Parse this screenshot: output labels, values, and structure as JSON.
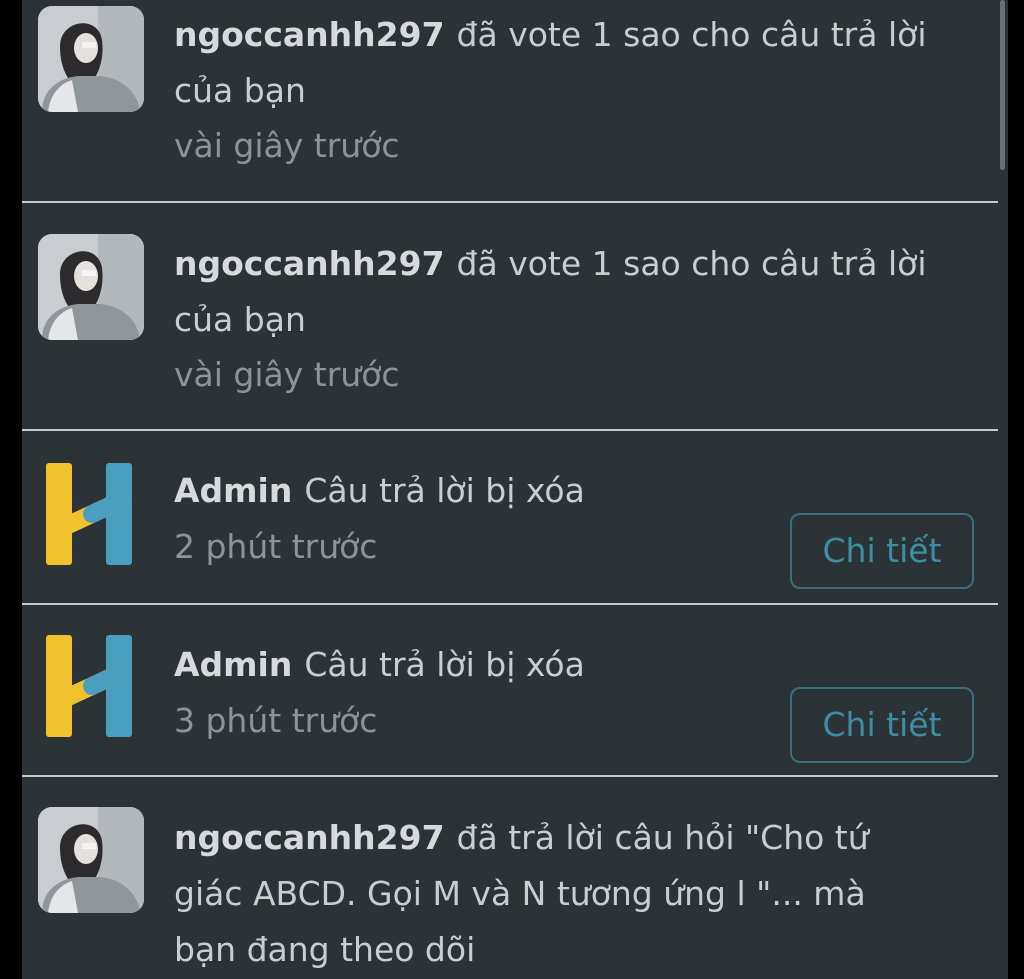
{
  "notifications": [
    {
      "user": "ngoccanhh297",
      "message": "đã vote 1 sao cho câu trả lời của bạn",
      "time": "vài giây trước",
      "avatar": "user-photo"
    },
    {
      "user": "ngoccanhh297",
      "message": "đã vote 1 sao cho câu trả lời của bạn",
      "time": "vài giây trước",
      "avatar": "user-photo"
    },
    {
      "user": "Admin",
      "message": "Câu trả lời bị xóa",
      "time": "2 phút trước",
      "avatar": "h-logo",
      "button": "Chi tiết"
    },
    {
      "user": "Admin",
      "message": "Câu trả lời bị xóa",
      "time": "3 phút trước",
      "avatar": "h-logo",
      "button": "Chi tiết"
    },
    {
      "user": "ngoccanhh297",
      "message": "đã trả lời câu hỏi \"Cho tứ giác ABCD. Gọi M và N tương ứng l \"... mà bạn đang theo dõi",
      "avatar": "user-photo"
    }
  ],
  "colors": {
    "background": "#2b3336",
    "logo_yellow": "#f2c12e",
    "logo_blue": "#4a9fc0",
    "button_border": "#3d6e7d",
    "button_text": "#3e8ea3"
  }
}
